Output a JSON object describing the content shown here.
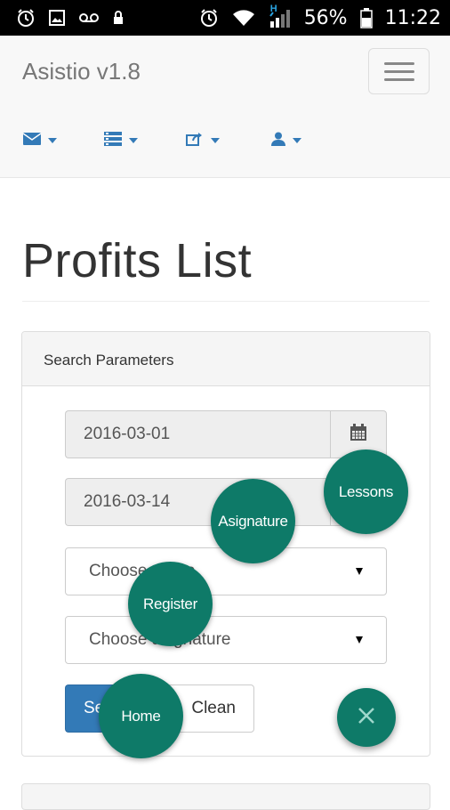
{
  "status_bar": {
    "battery": "56%",
    "time": "11:22",
    "network_label": "H"
  },
  "navbar": {
    "brand": "Asistio v1.8",
    "menus": [
      {
        "icon": "envelope-icon"
      },
      {
        "icon": "list-icon"
      },
      {
        "icon": "share-icon"
      },
      {
        "icon": "user-icon"
      }
    ]
  },
  "page": {
    "title": "Profits List"
  },
  "panel": {
    "heading": "Search Parameters",
    "date_from": "2016-03-01",
    "date_to": "2016-03-14",
    "group_select": "Choose group",
    "asignature_select": "Choose asignature",
    "search_label": "Search",
    "clean_label": "Clean"
  },
  "fab_menu": {
    "lessons": "Lessons",
    "asignature": "Asignature",
    "register": "Register",
    "home": "Home"
  },
  "colors": {
    "primary": "#337ab7",
    "fab": "#0e7a68"
  }
}
